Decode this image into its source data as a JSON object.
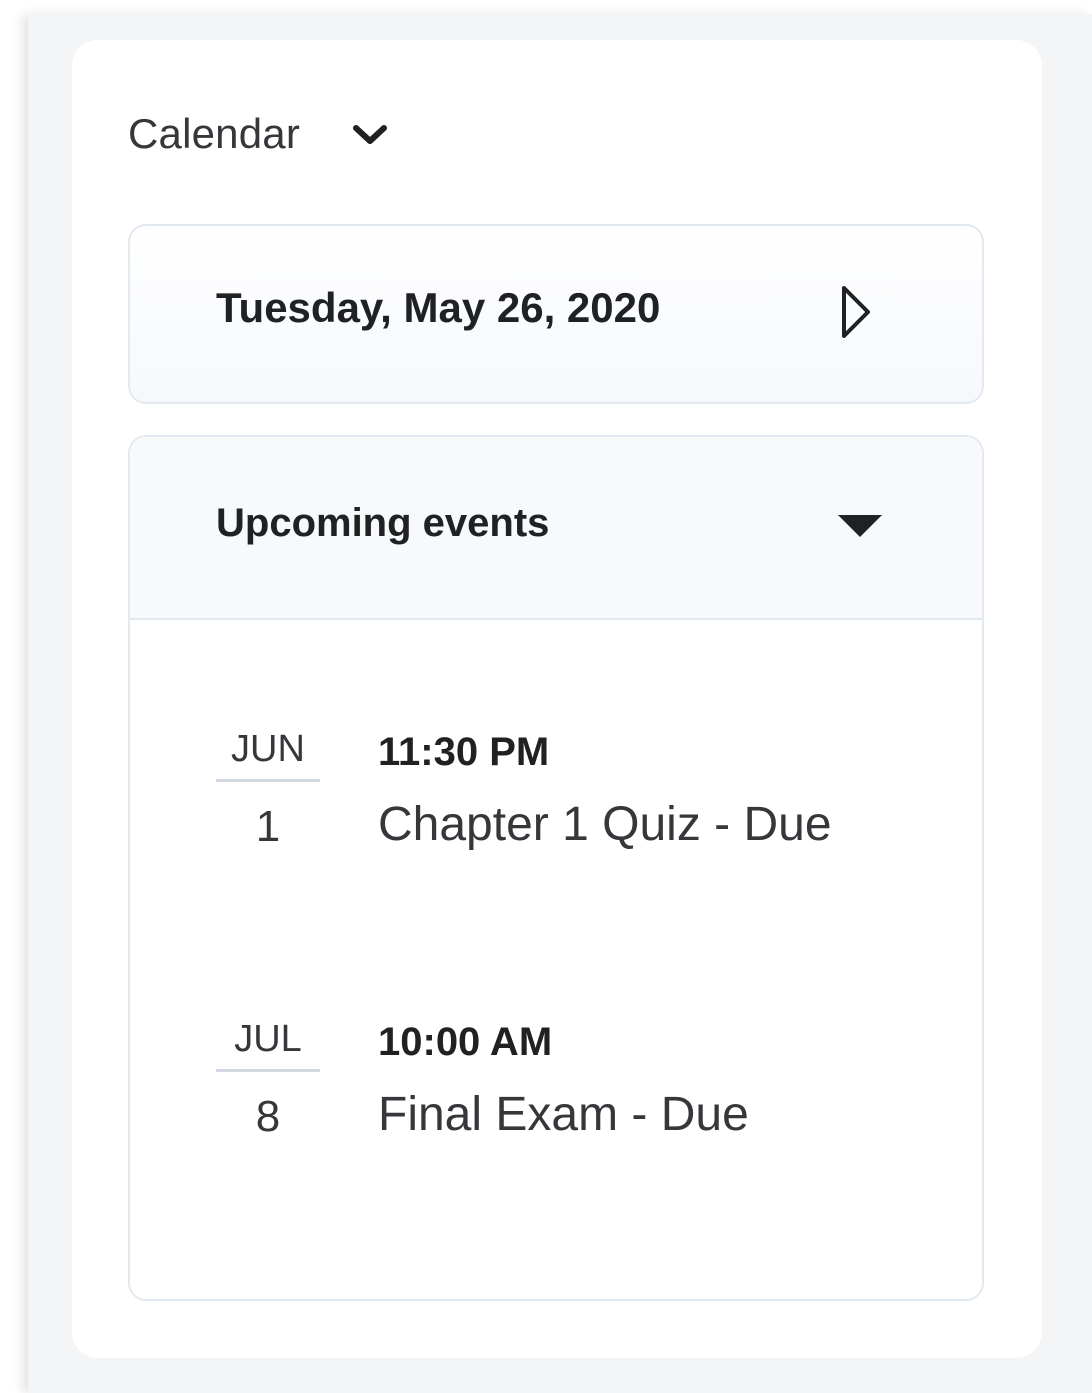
{
  "widget": {
    "title": "Calendar",
    "title_icon": "chevron-down-icon"
  },
  "date_nav": {
    "current_date": "Tuesday, May 26, 2020",
    "next_icon": "triangle-right-outline-icon"
  },
  "upcoming": {
    "title": "Upcoming events",
    "toggle_icon": "caret-down-icon",
    "events": [
      {
        "month": "JUN",
        "day": "1",
        "time": "11:30 PM",
        "name": "Chapter 1 Quiz - Due"
      },
      {
        "month": "JUL",
        "day": "8",
        "time": "10:00 AM",
        "name": "Final Exam - Due"
      }
    ]
  },
  "colors": {
    "text_primary": "#202122",
    "text_secondary": "#35373a",
    "border": "#e3e9f1",
    "panel_background": "#f4f5f6"
  }
}
